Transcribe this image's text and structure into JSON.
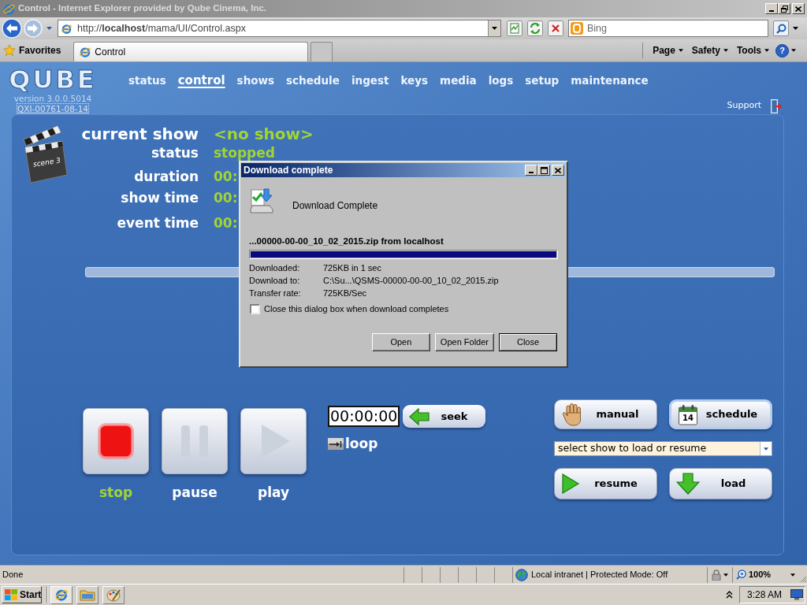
{
  "window": {
    "title": "Control - Internet Explorer provided by Qube Cinema, Inc."
  },
  "address_bar": {
    "url": "http://**localhost**/mama/UI/Control.aspx",
    "search_placeholder": "Bing"
  },
  "favorites_bar": {
    "favorites": "Favorites",
    "tabs": [
      {
        "label": "Control",
        "selected": true
      }
    ],
    "commands": [
      "Page",
      "Safety",
      "Tools"
    ],
    "help": "?"
  },
  "page": {
    "logo": "QUBE",
    "version": "version 3.0.0.5014",
    "serial": "QXI-00761-08-14",
    "nav": [
      {
        "label": "status",
        "selected": false
      },
      {
        "label": "control",
        "selected": true
      },
      {
        "label": "shows",
        "selected": false
      },
      {
        "label": "schedule",
        "selected": false
      },
      {
        "label": "ingest",
        "selected": false
      },
      {
        "label": "keys",
        "selected": false
      },
      {
        "label": "media",
        "selected": false
      },
      {
        "label": "logs",
        "selected": false
      },
      {
        "label": "setup",
        "selected": false
      },
      {
        "label": "maintenance",
        "selected": false
      }
    ],
    "support": "Support",
    "clapperboard": "scene 3",
    "current_show": {
      "label": "current show",
      "value": "<no show>"
    },
    "fields": [
      {
        "label": "status",
        "value": "stopped"
      },
      {
        "label": "duration",
        "value": "00:"
      },
      {
        "label": "show time",
        "value": "00:"
      },
      {
        "label": "event time",
        "value": "00:"
      }
    ],
    "transport": [
      {
        "kind": "stop",
        "label": "stop",
        "selected": true
      },
      {
        "kind": "pause",
        "label": "pause",
        "selected": false
      },
      {
        "kind": "play",
        "label": "play",
        "selected": false
      }
    ],
    "seek": {
      "time": "00:00:00",
      "label": "seek"
    },
    "loop": "loop",
    "modes": [
      {
        "kind": "manual",
        "label": "manual",
        "selected": false
      },
      {
        "kind": "schedule",
        "label": "schedule",
        "selected": true,
        "icon_text": "14"
      }
    ],
    "show_select": {
      "value": "select show to load or resume"
    },
    "actions": [
      {
        "kind": "resume",
        "label": "resume"
      },
      {
        "kind": "load",
        "label": "load"
      }
    ]
  },
  "dialog": {
    "title": "Download complete",
    "heading": "Download Complete",
    "file": "...00000-00-00_10_02_2015.zip from localhost",
    "progress": {
      "level": 1
    },
    "details": [
      {
        "label": "Downloaded:",
        "value": "725KB in 1 sec"
      },
      {
        "label": "Download to:",
        "value": "C:\\Su...\\QSMS-00000-00-00_10_02_2015.zip"
      },
      {
        "label": "Transfer rate:",
        "value": "725KB/Sec"
      }
    ],
    "close_when_done": {
      "label": "Close this dialog box when download completes",
      "checked": false
    },
    "buttons": [
      {
        "label": "Open",
        "focused": false
      },
      {
        "label": "Open Folder",
        "focused": false
      },
      {
        "label": "Close",
        "focused": true
      }
    ]
  },
  "status_bar": {
    "text": "Done",
    "zone": "Local intranet | Protected Mode: Off",
    "zoom": "100%"
  },
  "taskbar": {
    "start": "Start",
    "clock": "3:28 AM"
  }
}
